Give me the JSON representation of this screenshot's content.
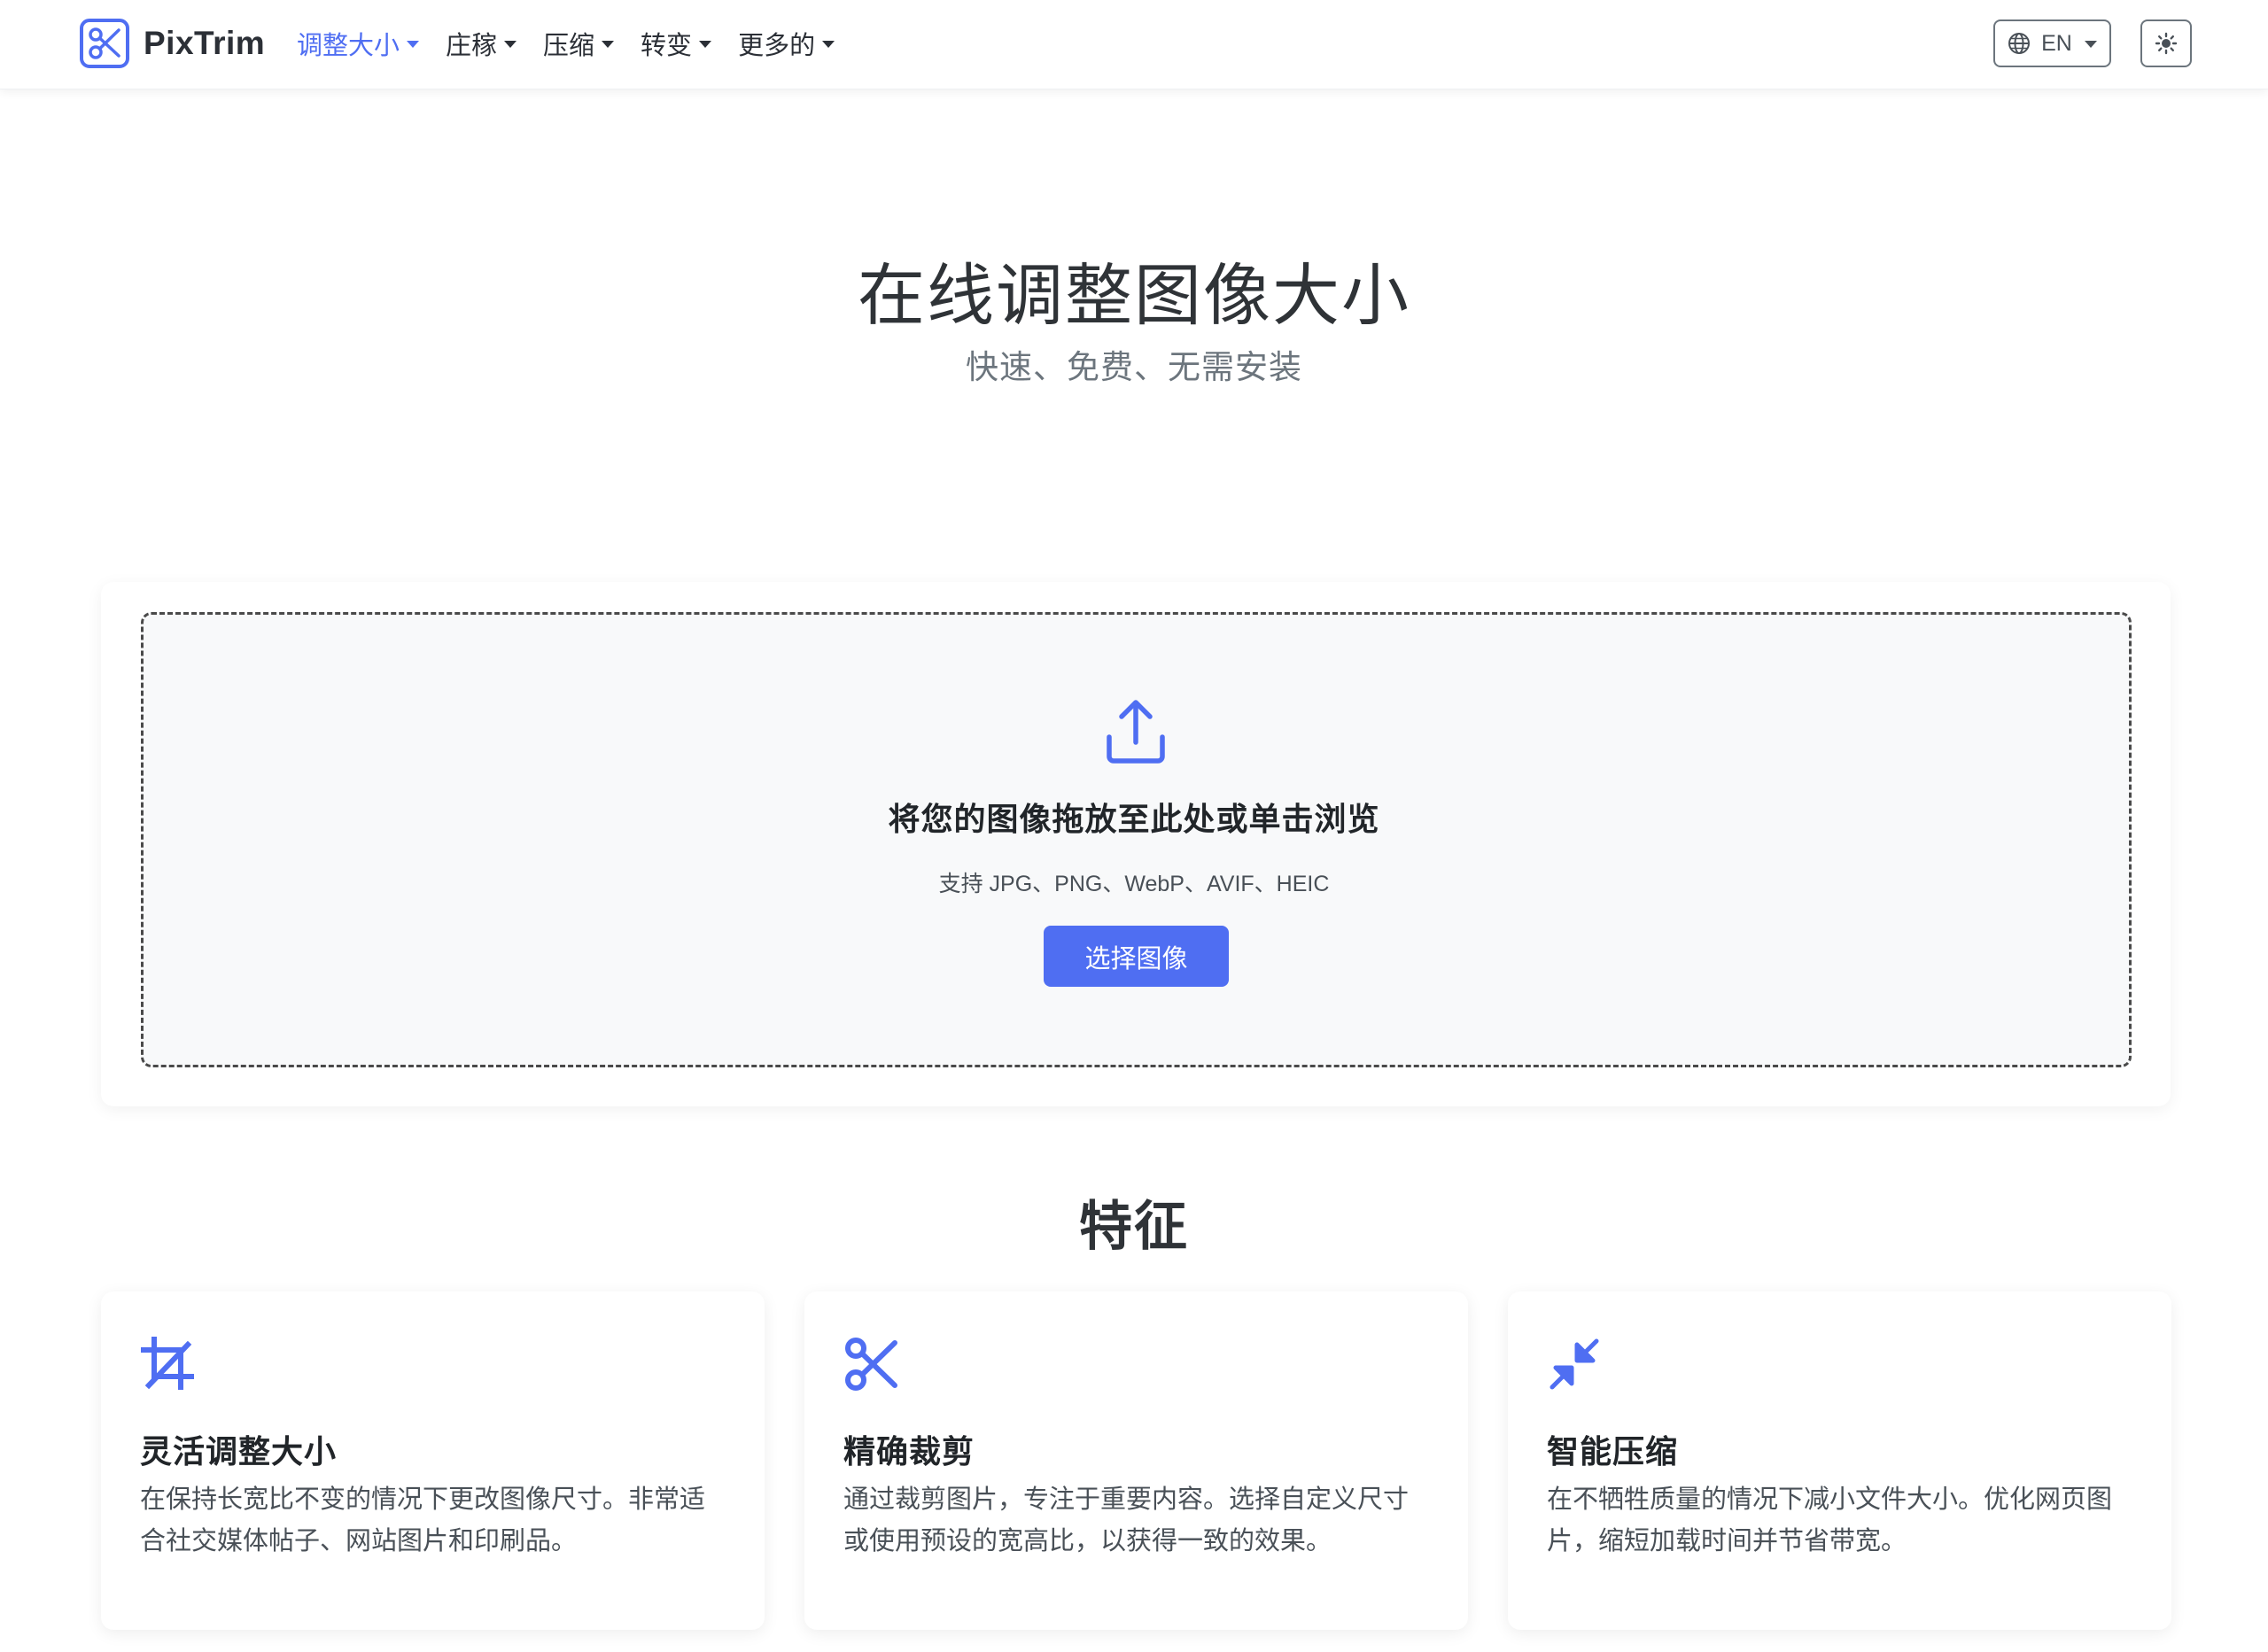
{
  "brand": {
    "name": "PixTrim"
  },
  "nav": {
    "items": [
      {
        "label": "调整大小",
        "active": true
      },
      {
        "label": "庄稼",
        "active": false
      },
      {
        "label": "压缩",
        "active": false
      },
      {
        "label": "转变",
        "active": false
      },
      {
        "label": "更多的",
        "active": false
      }
    ],
    "language": "EN"
  },
  "hero": {
    "title": "在线调整图像大小",
    "subtitle": "快速、免费、无需安装"
  },
  "upload": {
    "title": "将您的图像拖放至此处或单击浏览",
    "formats": "支持 JPG、PNG、WebP、AVIF、HEIC",
    "button_label": "选择图像"
  },
  "features": {
    "heading": "特征",
    "cards": [
      {
        "icon": "crop-icon",
        "title": "灵活调整大小",
        "description": "在保持长宽比不变的情况下更改图像尺寸。非常适合社交媒体帖子、网站图片和印刷品。"
      },
      {
        "icon": "scissors-icon",
        "title": "精确裁剪",
        "description": "通过裁剪图片，专注于重要内容。选择自定义尺寸或使用预设的宽高比，以获得一致的效果。"
      },
      {
        "icon": "compress-icon",
        "title": "智能压缩",
        "description": "在不牺牲质量的情况下减小文件大小。优化网页图片，缩短加载时间并节省带宽。"
      }
    ]
  },
  "colors": {
    "accent": "#4f6ef2",
    "text_dark": "#212529",
    "text_muted": "#6c757d",
    "dropzone_bg": "#f8f9fa"
  }
}
